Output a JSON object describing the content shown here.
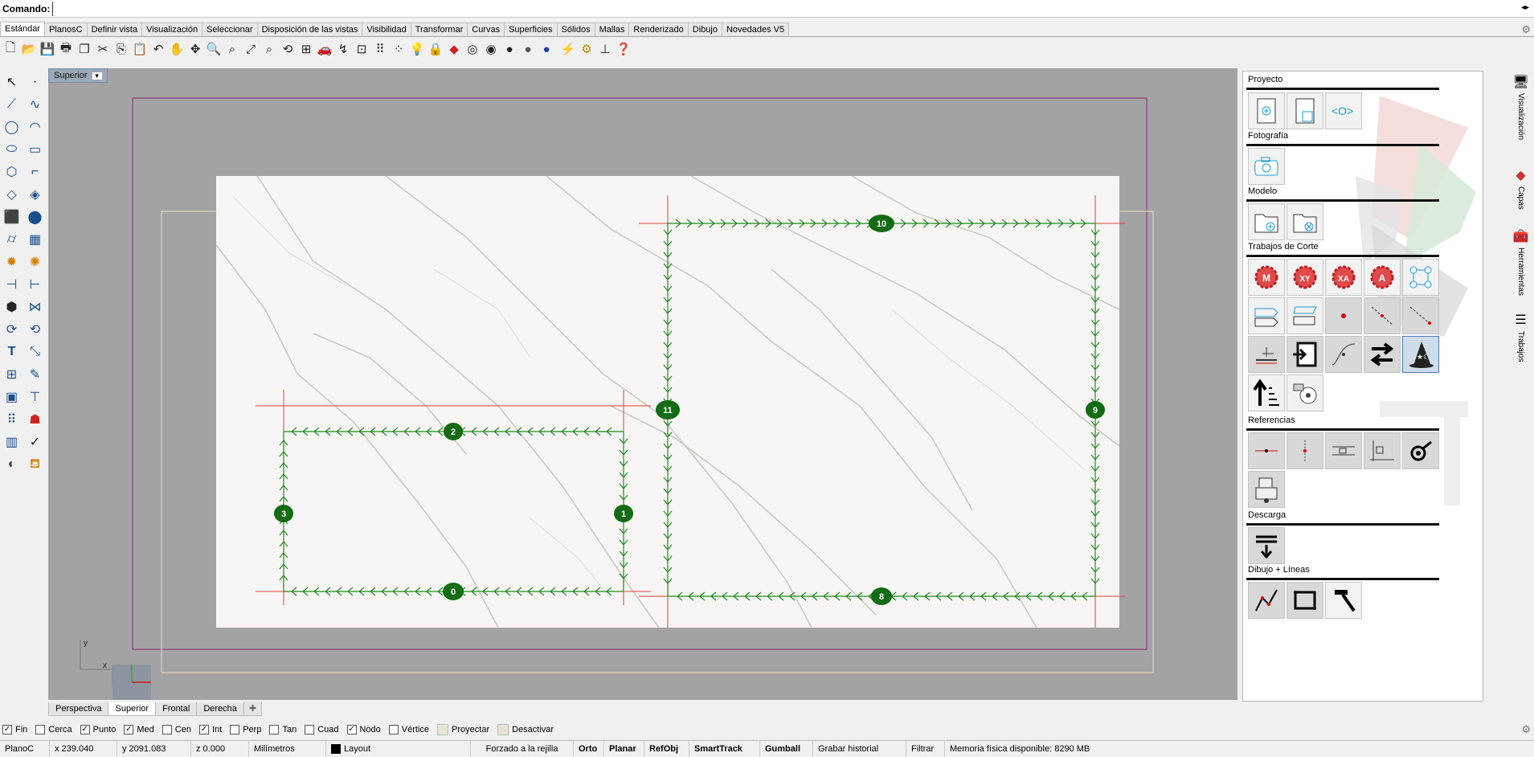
{
  "command": {
    "label": "Comando:",
    "value": ""
  },
  "tabs": [
    "Estándar",
    "PlanosC",
    "Definir vista",
    "Visualización",
    "Seleccionar",
    "Disposición de las vistas",
    "Visibilidad",
    "Transformar",
    "Curvas",
    "Superficies",
    "Sólidos",
    "Mallas",
    "Renderizado",
    "Dibujo",
    "Novedades V5"
  ],
  "active_tab": "Estándar",
  "viewport": {
    "title": "Superior",
    "axis_labels": {
      "x": "x",
      "y": "y"
    },
    "paths": [
      {
        "label": "0"
      },
      {
        "label": "1"
      },
      {
        "label": "2"
      },
      {
        "label": "3"
      },
      {
        "label": "8"
      },
      {
        "label": "9"
      },
      {
        "label": "10"
      },
      {
        "label": "11"
      }
    ]
  },
  "viewport_tabs": [
    "Perspectiva",
    "Superior",
    "Frontal",
    "Derecha"
  ],
  "active_viewport_tab": "Superior",
  "panel": {
    "sections": {
      "proyecto": "Proyecto",
      "fotografia": "Fotografía",
      "modelo": "Modelo",
      "trabajos": "Trabajos de Corte",
      "referencias": "Referencias",
      "descarga": "Descarga",
      "dibujo": "Dibujo + Líneas"
    }
  },
  "side_tabs": {
    "visualizacion": "Visualización",
    "capas": "Capas",
    "herramientas": "Herramientas",
    "trabajos": "Trabajos"
  },
  "snaps": [
    {
      "label": "Fin",
      "checked": true
    },
    {
      "label": "Cerca",
      "checked": false
    },
    {
      "label": "Punto",
      "checked": true
    },
    {
      "label": "Med",
      "checked": true
    },
    {
      "label": "Cen",
      "checked": false
    },
    {
      "label": "Int",
      "checked": true
    },
    {
      "label": "Perp",
      "checked": false
    },
    {
      "label": "Tan",
      "checked": false
    },
    {
      "label": "Cuad",
      "checked": false
    },
    {
      "label": "Nodo",
      "checked": true
    },
    {
      "label": "Vértice",
      "checked": false
    }
  ],
  "snap_buttons": {
    "proyectar": "Proyectar",
    "desactivar": "Desactivar"
  },
  "status": {
    "cplane": "PlanoC",
    "x": "x 239.040",
    "y": "y 2091.083",
    "z": "z 0.000",
    "units": "Milímetros",
    "layer": "Layout",
    "grid_snap": "Forzado a la rejilla",
    "orto": "Orto",
    "planar": "Planar",
    "osnap": "RefObj",
    "smarttrack": "SmartTrack",
    "gumball": "Gumball",
    "history": "Grabar historial",
    "filter": "Filtrar",
    "memory": "Memoria física disponible: 8290 MB"
  }
}
